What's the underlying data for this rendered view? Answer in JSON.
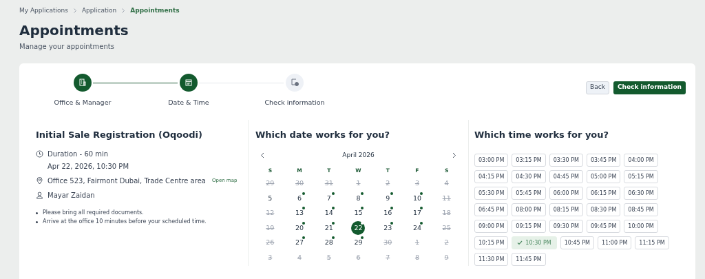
{
  "breadcrumbs": [
    {
      "label": "My Applications",
      "current": false
    },
    {
      "label": "Application",
      "current": false
    },
    {
      "label": "Appointments",
      "current": true
    }
  ],
  "page": {
    "title": "Appointments",
    "subtitle": "Manage your appointments"
  },
  "steps": [
    {
      "label": "Office & Manager",
      "done": true,
      "kind": "building"
    },
    {
      "label": "Date & Time",
      "done": true,
      "kind": "calendar"
    },
    {
      "label": "Check information",
      "done": false,
      "kind": "check"
    }
  ],
  "actions": {
    "back": "Back",
    "primary": "Check information"
  },
  "details": {
    "title": "Initial Sale Registration (Oqoodi)",
    "duration": "Duration - 60 min",
    "datetime": "Apr 22, 2026, 10:30 PM",
    "address": "Office 523, Fairmont Dubai, Trade Centre area",
    "map_link": "Open map",
    "manager": "Mayar Zaidan",
    "notes": [
      "Please bring all required documents.",
      "Arrive at the office 10 minutes before your scheduled time."
    ]
  },
  "date_section": {
    "title": "Which date works for you?",
    "month": "April 2026",
    "weekdays": [
      "S",
      "M",
      "T",
      "W",
      "T",
      "F",
      "S"
    ],
    "days": [
      {
        "label": "29",
        "disabled": true,
        "available": false,
        "selected": false
      },
      {
        "label": "30",
        "disabled": true,
        "available": false,
        "selected": false
      },
      {
        "label": "31",
        "disabled": true,
        "available": false,
        "selected": false
      },
      {
        "label": "1",
        "disabled": true,
        "available": false,
        "selected": false
      },
      {
        "label": "2",
        "disabled": true,
        "available": false,
        "selected": false
      },
      {
        "label": "3",
        "disabled": true,
        "available": false,
        "selected": false
      },
      {
        "label": "4",
        "disabled": true,
        "available": false,
        "selected": false
      },
      {
        "label": "5",
        "disabled": false,
        "available": false,
        "selected": false
      },
      {
        "label": "6",
        "disabled": false,
        "available": true,
        "selected": false
      },
      {
        "label": "7",
        "disabled": false,
        "available": true,
        "selected": false
      },
      {
        "label": "8",
        "disabled": false,
        "available": true,
        "selected": false
      },
      {
        "label": "9",
        "disabled": false,
        "available": true,
        "selected": false
      },
      {
        "label": "10",
        "disabled": false,
        "available": true,
        "selected": false
      },
      {
        "label": "11",
        "disabled": true,
        "available": false,
        "selected": false
      },
      {
        "label": "12",
        "disabled": true,
        "available": false,
        "selected": false
      },
      {
        "label": "13",
        "disabled": false,
        "available": true,
        "selected": false
      },
      {
        "label": "14",
        "disabled": false,
        "available": true,
        "selected": false
      },
      {
        "label": "15",
        "disabled": false,
        "available": true,
        "selected": false
      },
      {
        "label": "16",
        "disabled": false,
        "available": true,
        "selected": false
      },
      {
        "label": "17",
        "disabled": false,
        "available": true,
        "selected": false
      },
      {
        "label": "18",
        "disabled": true,
        "available": false,
        "selected": false
      },
      {
        "label": "19",
        "disabled": true,
        "available": false,
        "selected": false
      },
      {
        "label": "20",
        "disabled": false,
        "available": true,
        "selected": false
      },
      {
        "label": "21",
        "disabled": false,
        "available": true,
        "selected": false
      },
      {
        "label": "22",
        "disabled": false,
        "available": true,
        "selected": true
      },
      {
        "label": "23",
        "disabled": false,
        "available": true,
        "selected": false
      },
      {
        "label": "24",
        "disabled": false,
        "available": true,
        "selected": false
      },
      {
        "label": "25",
        "disabled": true,
        "available": false,
        "selected": false
      },
      {
        "label": "26",
        "disabled": true,
        "available": false,
        "selected": false
      },
      {
        "label": "27",
        "disabled": false,
        "available": true,
        "selected": false
      },
      {
        "label": "28",
        "disabled": false,
        "available": true,
        "selected": false
      },
      {
        "label": "29",
        "disabled": false,
        "available": true,
        "selected": false
      },
      {
        "label": "30",
        "disabled": true,
        "available": false,
        "selected": false
      },
      {
        "label": "1",
        "disabled": true,
        "available": false,
        "selected": false
      },
      {
        "label": "2",
        "disabled": true,
        "available": false,
        "selected": false
      },
      {
        "label": "3",
        "disabled": true,
        "available": false,
        "selected": false
      },
      {
        "label": "4",
        "disabled": true,
        "available": false,
        "selected": false
      },
      {
        "label": "5",
        "disabled": true,
        "available": false,
        "selected": false
      },
      {
        "label": "6",
        "disabled": true,
        "available": false,
        "selected": false
      },
      {
        "label": "7",
        "disabled": true,
        "available": false,
        "selected": false
      },
      {
        "label": "8",
        "disabled": true,
        "available": false,
        "selected": false
      },
      {
        "label": "9",
        "disabled": true,
        "available": false,
        "selected": false
      }
    ]
  },
  "time_section": {
    "title": "Which time works for you?",
    "slots": [
      {
        "label": "03:00 PM",
        "selected": false
      },
      {
        "label": "03:15 PM",
        "selected": false
      },
      {
        "label": "03:30 PM",
        "selected": false
      },
      {
        "label": "03:45 PM",
        "selected": false
      },
      {
        "label": "04:00 PM",
        "selected": false
      },
      {
        "label": "04:15 PM",
        "selected": false
      },
      {
        "label": "04:30 PM",
        "selected": false
      },
      {
        "label": "04:45 PM",
        "selected": false
      },
      {
        "label": "05:00 PM",
        "selected": false
      },
      {
        "label": "05:15 PM",
        "selected": false
      },
      {
        "label": "05:30 PM",
        "selected": false
      },
      {
        "label": "05:45 PM",
        "selected": false
      },
      {
        "label": "06:00 PM",
        "selected": false
      },
      {
        "label": "06:15 PM",
        "selected": false
      },
      {
        "label": "06:30 PM",
        "selected": false
      },
      {
        "label": "06:45 PM",
        "selected": false
      },
      {
        "label": "08:00 PM",
        "selected": false
      },
      {
        "label": "08:15 PM",
        "selected": false
      },
      {
        "label": "08:30 PM",
        "selected": false
      },
      {
        "label": "08:45 PM",
        "selected": false
      },
      {
        "label": "09:00 PM",
        "selected": false
      },
      {
        "label": "09:15 PM",
        "selected": false
      },
      {
        "label": "09:30 PM",
        "selected": false
      },
      {
        "label": "09:45 PM",
        "selected": false
      },
      {
        "label": "10:00 PM",
        "selected": false
      },
      {
        "label": "10:15 PM",
        "selected": false
      },
      {
        "label": "10:30 PM",
        "selected": true
      },
      {
        "label": "10:45 PM",
        "selected": false
      },
      {
        "label": "11:00 PM",
        "selected": false
      },
      {
        "label": "11:15 PM",
        "selected": false
      },
      {
        "label": "11:30 PM",
        "selected": false
      },
      {
        "label": "11:45 PM",
        "selected": false
      }
    ]
  }
}
